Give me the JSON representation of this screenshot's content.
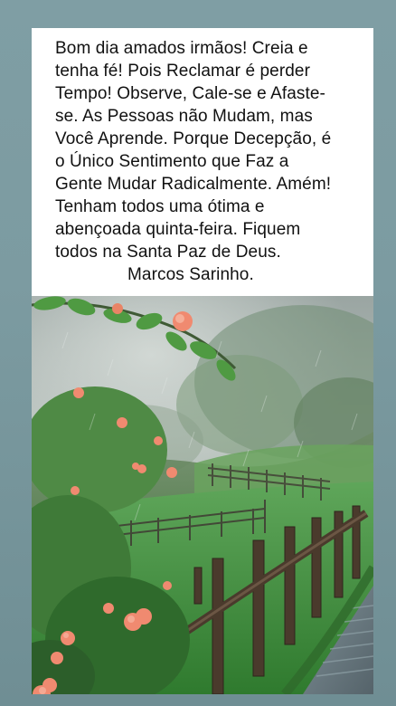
{
  "post": {
    "caption_lines": [
      "Bom dia amados irmãos! Creia e",
      "tenha fé! Pois Reclamar é perder",
      "Tempo! Observe, Cale-se e Afaste-",
      "se. As Pessoas não Mudam, mas",
      "Você Aprende. Porque Decepção, é",
      "o Único Sentimento que Faz a",
      "Gente Mudar Radicalmente. Amém!",
      "Tenham todos uma ótima e",
      "abençoada quinta-feira. Fiquem",
      "todos na Santa Paz de Deus."
    ],
    "signature": "Marcos Sarinho."
  },
  "photo": {
    "subject": "rainy-garden-path-with-fence-and-roses",
    "colors": {
      "background": "#7f9ea4",
      "mist": "#b8c4c0",
      "grass": "#3f8f3a",
      "fence": "#4a3a2c",
      "rose": "#f08a70"
    }
  }
}
